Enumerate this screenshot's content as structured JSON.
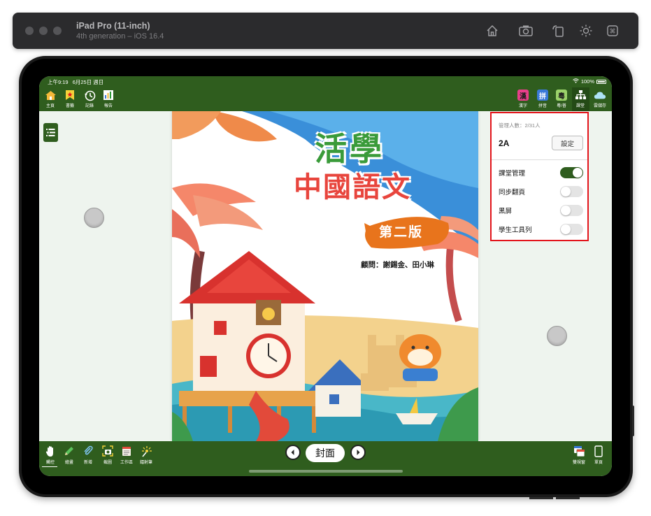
{
  "simulator": {
    "title": "iPad Pro (11-inch)",
    "subtitle": "4th generation – iOS 16.4",
    "icons": [
      "home-icon",
      "screenshot-icon",
      "rotate-icon",
      "appearance-icon",
      "command-icon"
    ]
  },
  "status": {
    "time": "上午9:19",
    "date": "6月25日 週日",
    "battery": "100%"
  },
  "toolbar_left": [
    {
      "label": "主頁",
      "icon": "home-icon"
    },
    {
      "label": "書籤",
      "icon": "bookmark-icon"
    },
    {
      "label": "記錄",
      "icon": "history-icon"
    },
    {
      "label": "報告",
      "icon": "report-icon"
    }
  ],
  "toolbar_right": [
    {
      "label": "漢字",
      "glyph": "漢",
      "icon": "hanzi-icon",
      "bg": "#e83f8a",
      "fg": "#1b1b1b"
    },
    {
      "label": "拼音",
      "glyph": "拼",
      "icon": "pinyin-icon",
      "bg": "#3a79d8",
      "fg": "#ffffff"
    },
    {
      "label": "粵/普",
      "glyph": "粵",
      "icon": "cantonese-icon",
      "bg": "#9bd36a",
      "fg": "#1b1b1b"
    },
    {
      "label": "課堂",
      "icon": "classroom-icon"
    },
    {
      "label": "雲儲存",
      "icon": "cloud-icon"
    }
  ],
  "panel": {
    "manager_count": "管理人數：2/31人",
    "class_name": "2A",
    "settings_label": "設定",
    "toggles": [
      {
        "label": "課堂管理",
        "on": true
      },
      {
        "label": "同步翻頁",
        "on": false
      },
      {
        "label": "黑屏",
        "on": false
      },
      {
        "label": "學生工具列",
        "on": false
      }
    ]
  },
  "book": {
    "title_line1": "活學",
    "title_line2": "中國語文",
    "edition": "第二版",
    "advisors": "顧問：謝錫金、田小琳"
  },
  "bottom_left": [
    {
      "label": "觸控",
      "icon": "touch-icon"
    },
    {
      "label": "繪畫",
      "icon": "pen-icon"
    },
    {
      "label": "新增",
      "icon": "paperclip-icon"
    },
    {
      "label": "截圖",
      "icon": "capture-icon"
    },
    {
      "label": "工作區",
      "icon": "workspace-icon"
    },
    {
      "label": "鐳射筆",
      "icon": "laser-icon"
    }
  ],
  "page_label": "封面",
  "bottom_right": [
    {
      "label": "雙視窗",
      "icon": "dual-view-icon"
    },
    {
      "label": "單頁",
      "icon": "single-page-icon"
    }
  ],
  "colors": {
    "bar_green": "#2f5d1e",
    "highlight_red": "#e3141b",
    "edition_orange": "#e8741c"
  }
}
